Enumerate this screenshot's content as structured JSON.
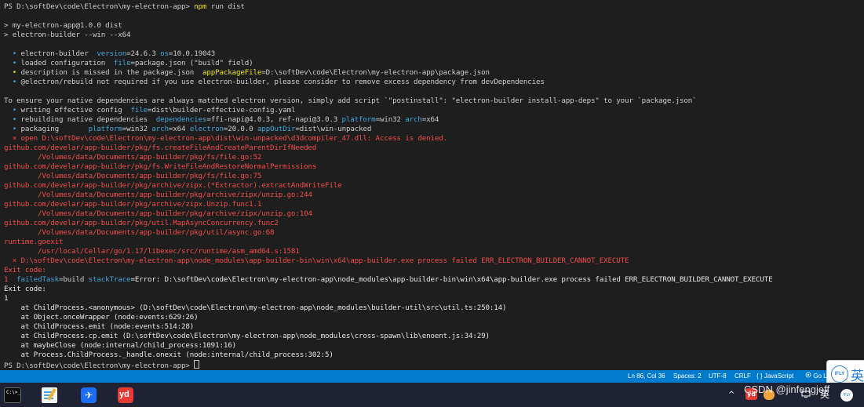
{
  "terminal": {
    "lines": [
      {
        "segs": [
          {
            "t": "PS D:\\softDev\\code\\Electron\\my-electron-app> ",
            "c": "default"
          },
          {
            "t": "npm ",
            "c": "yellow"
          },
          {
            "t": "run dist",
            "c": "default"
          }
        ]
      },
      {
        "segs": [
          {
            "t": "",
            "c": "default"
          }
        ]
      },
      {
        "segs": [
          {
            "t": "> my-electron-app@1.0.0 dist",
            "c": "default"
          }
        ]
      },
      {
        "segs": [
          {
            "t": "> electron-builder --win --x64",
            "c": "default"
          }
        ]
      },
      {
        "segs": [
          {
            "t": "",
            "c": "default"
          }
        ]
      },
      {
        "segs": [
          {
            "t": "  • ",
            "c": "cyan"
          },
          {
            "t": "electron-builder  ",
            "c": "default"
          },
          {
            "t": "version",
            "c": "cyan"
          },
          {
            "t": "=24.6.3 ",
            "c": "default"
          },
          {
            "t": "os",
            "c": "cyan"
          },
          {
            "t": "=10.0.19043",
            "c": "default"
          }
        ]
      },
      {
        "segs": [
          {
            "t": "  • ",
            "c": "cyan"
          },
          {
            "t": "loaded configuration  ",
            "c": "default"
          },
          {
            "t": "file",
            "c": "cyan"
          },
          {
            "t": "=package.json (\"build\" field)",
            "c": "default"
          }
        ]
      },
      {
        "segs": [
          {
            "t": "  • ",
            "c": "yellow"
          },
          {
            "t": "description is missed in the package.json  ",
            "c": "default"
          },
          {
            "t": "appPackageFile",
            "c": "yellow"
          },
          {
            "t": "=D:\\softDev\\code\\Electron\\my-electron-app\\package.json",
            "c": "default"
          }
        ]
      },
      {
        "segs": [
          {
            "t": "  • ",
            "c": "cyan"
          },
          {
            "t": "@electron/rebuild not required if you use electron-builder, please consider to remove excess dependency from devDependencies",
            "c": "default"
          }
        ]
      },
      {
        "segs": [
          {
            "t": "",
            "c": "default"
          }
        ]
      },
      {
        "segs": [
          {
            "t": "To ensure your native dependencies are always matched electron version, simply add script `\"postinstall\": \"electron-builder install-app-deps\" to your `package.json`",
            "c": "default"
          }
        ]
      },
      {
        "segs": [
          {
            "t": "  • ",
            "c": "cyan"
          },
          {
            "t": "writing effective config  ",
            "c": "default"
          },
          {
            "t": "file",
            "c": "cyan"
          },
          {
            "t": "=dist\\builder-effective-config.yaml",
            "c": "default"
          }
        ]
      },
      {
        "segs": [
          {
            "t": "  • ",
            "c": "cyan"
          },
          {
            "t": "rebuilding native dependencies  ",
            "c": "default"
          },
          {
            "t": "dependencies",
            "c": "cyan"
          },
          {
            "t": "=ffi-napi@4.0.3, ref-napi@3.0.3 ",
            "c": "default"
          },
          {
            "t": "platform",
            "c": "cyan"
          },
          {
            "t": "=win32 ",
            "c": "default"
          },
          {
            "t": "arch",
            "c": "cyan"
          },
          {
            "t": "=x64",
            "c": "default"
          }
        ]
      },
      {
        "segs": [
          {
            "t": "  • ",
            "c": "cyan"
          },
          {
            "t": "packaging       ",
            "c": "default"
          },
          {
            "t": "platform",
            "c": "cyan"
          },
          {
            "t": "=win32 ",
            "c": "default"
          },
          {
            "t": "arch",
            "c": "cyan"
          },
          {
            "t": "=x64 ",
            "c": "default"
          },
          {
            "t": "electron",
            "c": "cyan"
          },
          {
            "t": "=20.0.0 ",
            "c": "default"
          },
          {
            "t": "appOutDir",
            "c": "cyan"
          },
          {
            "t": "=dist\\win-unpacked",
            "c": "default"
          }
        ]
      },
      {
        "segs": [
          {
            "t": "  ⨯ open D:\\softDev\\code\\Electron\\my-electron-app\\dist\\win-unpacked\\d3dcompiler_47.dll: Access is denied.",
            "c": "red"
          }
        ]
      },
      {
        "segs": [
          {
            "t": "github.com/develar/app-builder/pkg/fs.createFileAndCreateParentDirIfNeeded",
            "c": "red"
          }
        ]
      },
      {
        "segs": [
          {
            "t": "        /Volumes/data/Documents/app-builder/pkg/fs/file.go:52",
            "c": "red"
          }
        ]
      },
      {
        "segs": [
          {
            "t": "github.com/develar/app-builder/pkg/fs.WriteFileAndRestoreNormalPermissions",
            "c": "red"
          }
        ]
      },
      {
        "segs": [
          {
            "t": "        /Volumes/data/Documents/app-builder/pkg/fs/file.go:75",
            "c": "red"
          }
        ]
      },
      {
        "segs": [
          {
            "t": "github.com/develar/app-builder/pkg/archive/zipx.(*Extractor).extractAndWriteFile",
            "c": "red"
          }
        ]
      },
      {
        "segs": [
          {
            "t": "        /Volumes/data/Documents/app-builder/pkg/archive/zipx/unzip.go:244",
            "c": "red"
          }
        ]
      },
      {
        "segs": [
          {
            "t": "github.com/develar/app-builder/pkg/archive/zipx.Unzip.func1.1",
            "c": "red"
          }
        ]
      },
      {
        "segs": [
          {
            "t": "        /Volumes/data/Documents/app-builder/pkg/archive/zipx/unzip.go:104",
            "c": "red"
          }
        ]
      },
      {
        "segs": [
          {
            "t": "github.com/develar/app-builder/pkg/util.MapAsyncConcurrency.func2",
            "c": "red"
          }
        ]
      },
      {
        "segs": [
          {
            "t": "        /Volumes/data/Documents/app-builder/pkg/util/async.go:68",
            "c": "red"
          }
        ]
      },
      {
        "segs": [
          {
            "t": "runtime.goexit",
            "c": "red"
          }
        ]
      },
      {
        "segs": [
          {
            "t": "        /usr/local/Cellar/go/1.17/libexec/src/runtime/asm_amd64.s:1581",
            "c": "red"
          }
        ]
      },
      {
        "segs": [
          {
            "t": "  ⨯ D:\\softDev\\code\\Electron\\my-electron-app\\node_modules\\app-builder-bin\\win\\x64\\app-builder.exe process failed ERR_ELECTRON_BUILDER_CANNOT_EXECUTE",
            "c": "red"
          }
        ]
      },
      {
        "segs": [
          {
            "t": "Exit code:",
            "c": "red"
          }
        ]
      },
      {
        "segs": [
          {
            "t": "1  ",
            "c": "red"
          },
          {
            "t": "failedTask",
            "c": "cyan"
          },
          {
            "t": "=build ",
            "c": "default"
          },
          {
            "t": "stackTrace",
            "c": "cyan"
          },
          {
            "t": "=Error: D:\\softDev\\code\\Electron\\my-electron-app\\node_modules\\app-builder-bin\\win\\x64\\app-builder.exe process failed ERR_ELECTRON_BUILDER_CANNOT_EXECUTE",
            "c": "white"
          }
        ]
      },
      {
        "segs": [
          {
            "t": "Exit code:",
            "c": "white"
          }
        ]
      },
      {
        "segs": [
          {
            "t": "1",
            "c": "white"
          }
        ]
      },
      {
        "segs": [
          {
            "t": "    at ChildProcess.<anonymous> (D:\\softDev\\code\\Electron\\my-electron-app\\node_modules\\builder-util\\src\\util.ts:250:14)",
            "c": "white"
          }
        ]
      },
      {
        "segs": [
          {
            "t": "    at Object.onceWrapper (node:events:629:26)",
            "c": "white"
          }
        ]
      },
      {
        "segs": [
          {
            "t": "    at ChildProcess.emit (node:events:514:28)",
            "c": "white"
          }
        ]
      },
      {
        "segs": [
          {
            "t": "    at ChildProcess.cp.emit (D:\\softDev\\code\\Electron\\my-electron-app\\node_modules\\cross-spawn\\lib\\enoent.js:34:29)",
            "c": "white"
          }
        ]
      },
      {
        "segs": [
          {
            "t": "    at maybeClose (node:internal/child_process:1091:16)",
            "c": "white"
          }
        ]
      },
      {
        "segs": [
          {
            "t": "    at Process.ChildProcess._handle.onexit (node:internal/child_process:302:5)",
            "c": "white"
          }
        ]
      },
      {
        "segs": [
          {
            "t": "PS D:\\softDev\\code\\Electron\\my-electron-app> ",
            "c": "default"
          }
        ],
        "cursor": true
      }
    ]
  },
  "statusbar": {
    "position": "Ln 86, Col 36",
    "spaces": "Spaces: 2",
    "encoding": "UTF-8",
    "eol": "CRLF",
    "language_icon": "{ }",
    "language": "JavaScript",
    "golive_icon": "broadcast-icon",
    "golive": "Go Li"
  },
  "ime": {
    "logo": "iFLY",
    "char": "英"
  },
  "taskbar": {
    "apps": [
      {
        "id": "terminal",
        "icon": "terminal-icon",
        "glyph": "C:\\>_"
      },
      {
        "id": "notepad",
        "icon": "notepad-icon"
      },
      {
        "id": "feishu",
        "icon": "feishu-icon",
        "glyph": "✈"
      },
      {
        "id": "youdao",
        "icon": "youdao-icon",
        "glyph": "yd"
      }
    ],
    "tray": {
      "chevron": "^",
      "ime_char": "英",
      "watermark": "CSDN @jinfengjeff"
    }
  },
  "colors": {
    "terminal_bg": "#1e1e1e",
    "statusbar_bg": "#007acc",
    "taskbar_bg": "#1f2232",
    "error_red": "#f14c4c",
    "info_cyan": "#40a6d9",
    "warn_yellow": "#e5e510"
  }
}
